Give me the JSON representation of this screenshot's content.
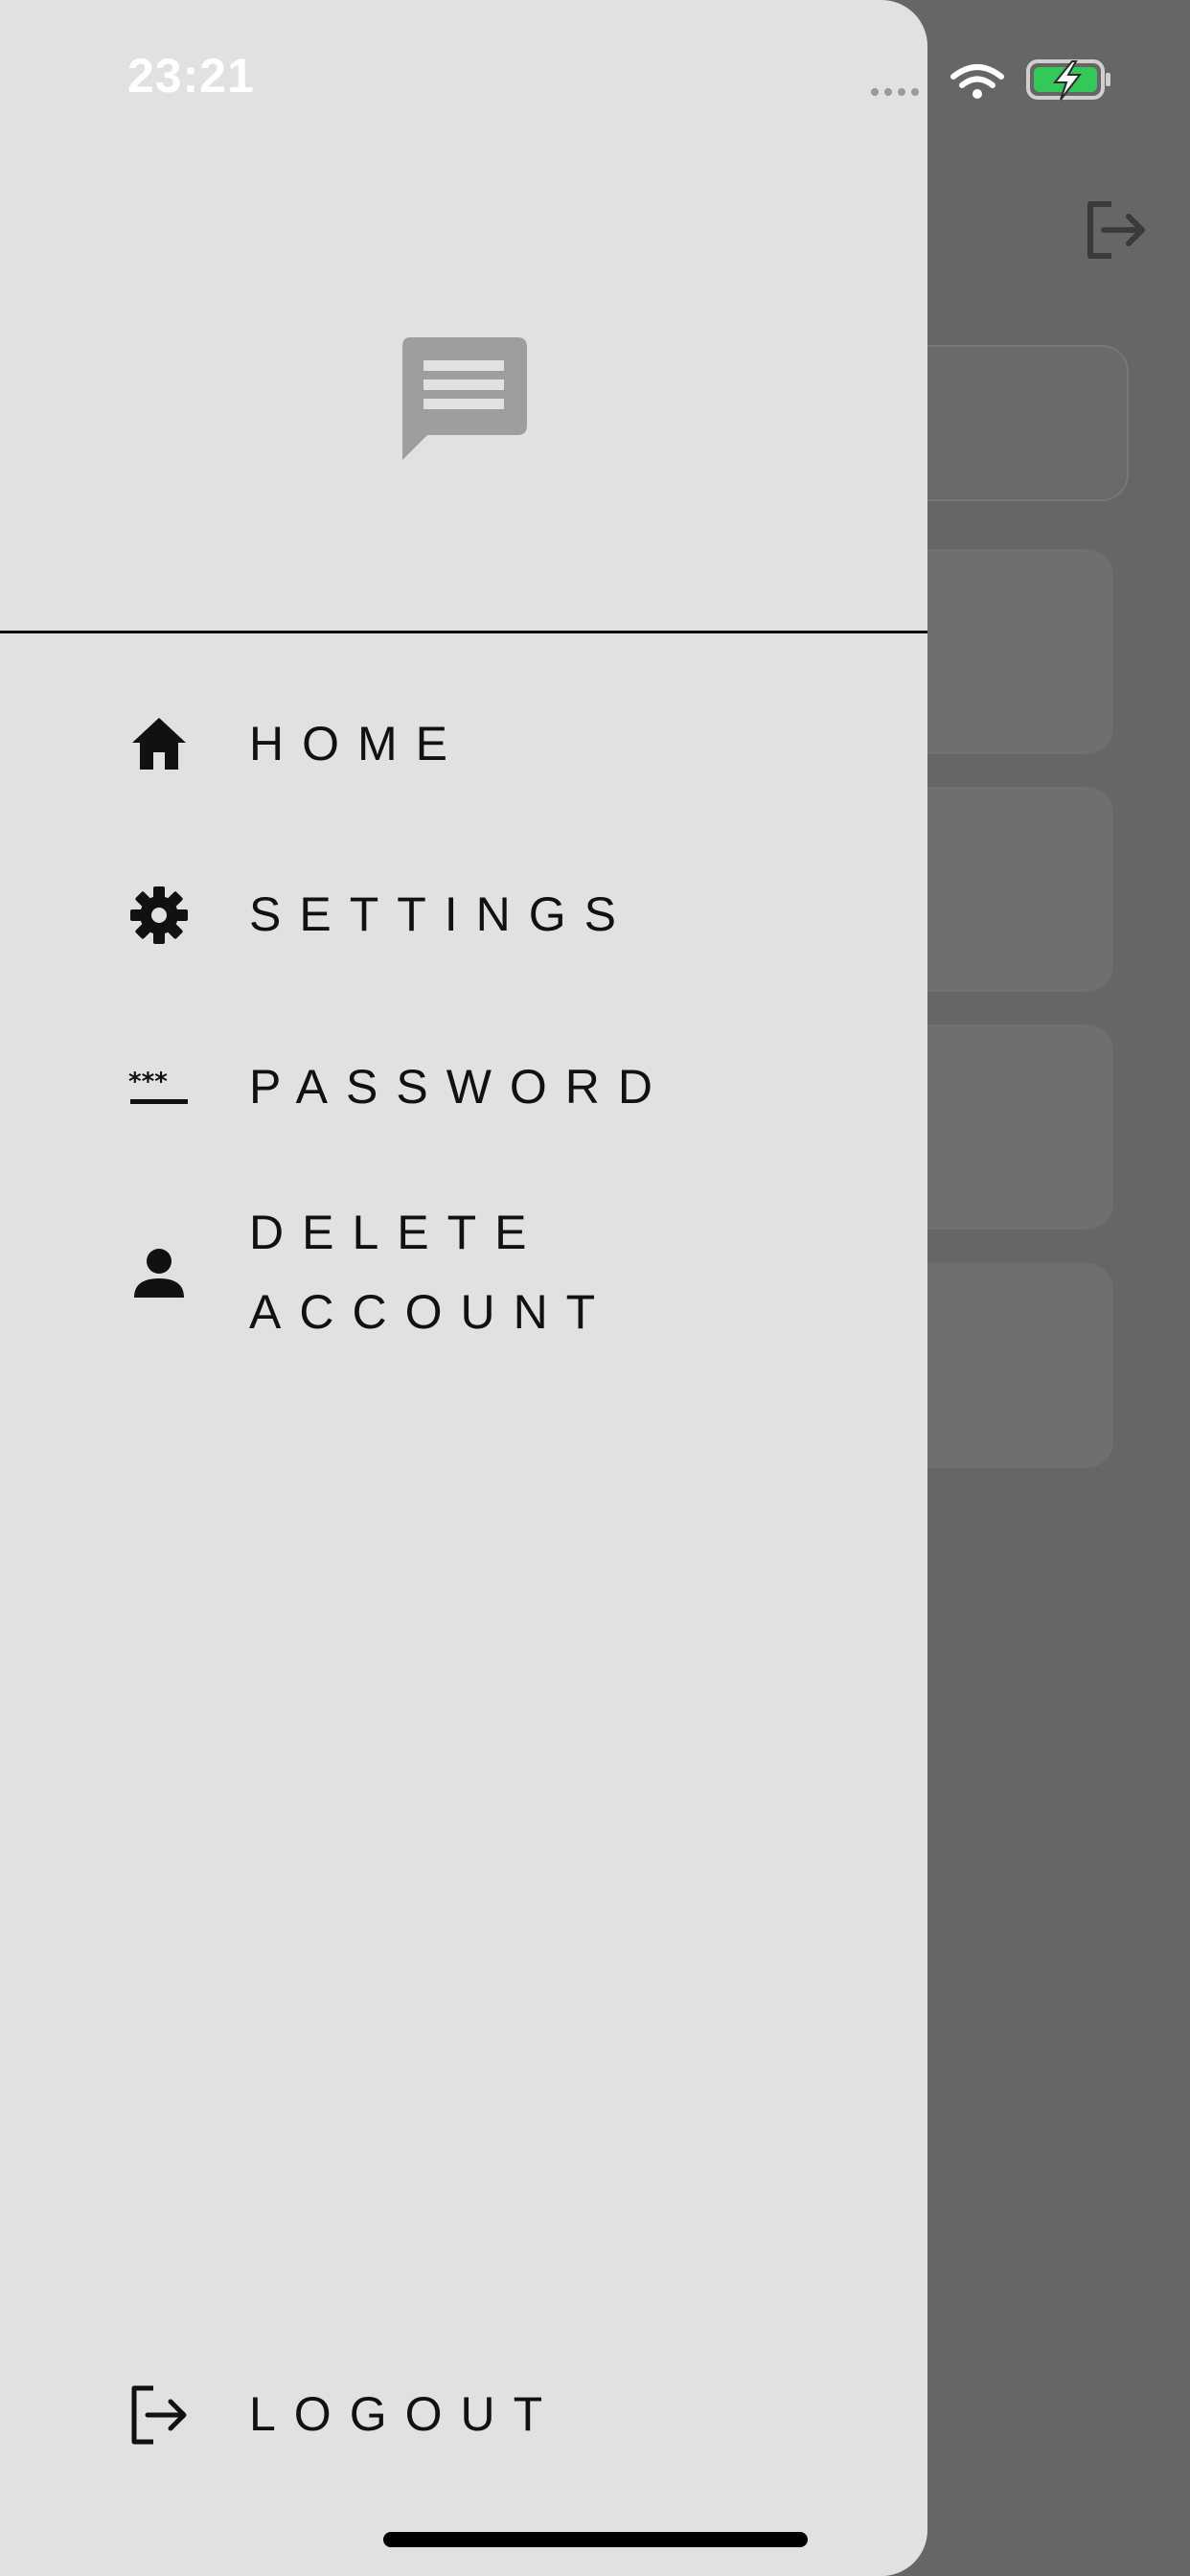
{
  "status_bar": {
    "time": "23:21"
  },
  "drawer": {
    "menu": [
      {
        "label": "HOME",
        "icon": "home-icon"
      },
      {
        "label": "SETTINGS",
        "icon": "gear-icon"
      },
      {
        "label": "PASSWORD",
        "icon": "password-icon"
      },
      {
        "label_line1": "DELETE",
        "label_line2": "ACCOUNT",
        "icon": "person-icon"
      }
    ],
    "logout": {
      "label": "LOGOUT",
      "icon": "logout-icon"
    }
  },
  "colors": {
    "drawer_bg": "#e1e1e1",
    "backdrop": "#666666",
    "battery_green": "#34c759"
  }
}
